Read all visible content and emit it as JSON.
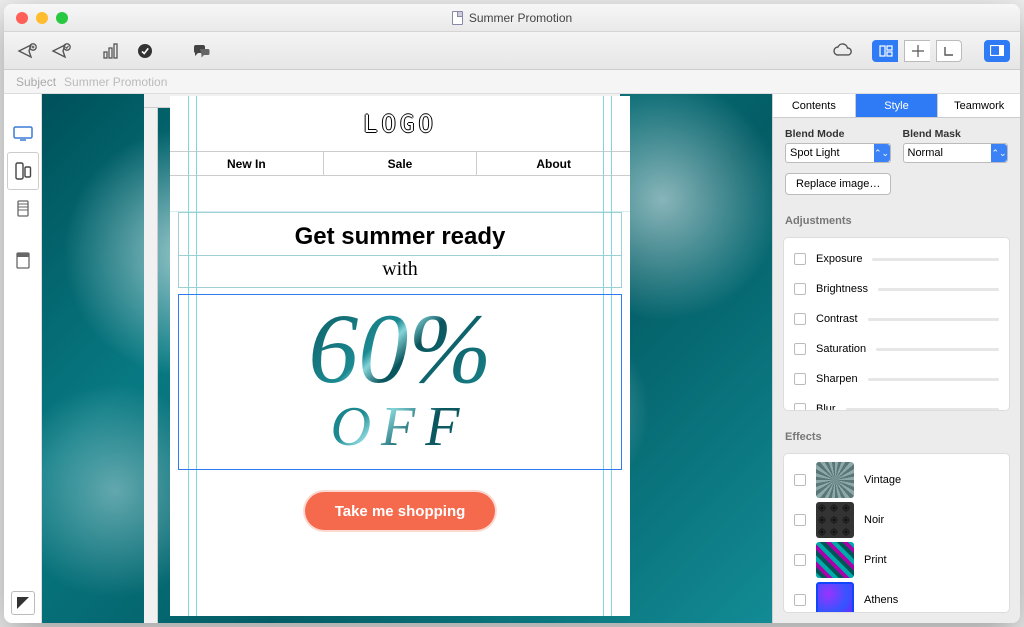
{
  "titlebar": {
    "title": "Summer Promotion"
  },
  "subject": {
    "label": "Subject",
    "value": "Summer Promotion"
  },
  "email": {
    "logo": "LOGO",
    "nav": [
      "New In",
      "Sale",
      "About"
    ],
    "headline": "Get summer ready",
    "sub": "with",
    "percent": "60%",
    "off": "OFF",
    "cta": "Take me shopping"
  },
  "inspector": {
    "tabs": [
      "Contents",
      "Style",
      "Teamwork"
    ],
    "active_tab": 1,
    "blend": {
      "mode_label": "Blend Mode",
      "mode_value": "Spot Light",
      "mask_label": "Blend Mask",
      "mask_value": "Normal"
    },
    "replace_btn": "Replace image…",
    "adjustments_label": "Adjustments",
    "adjustments": [
      "Exposure",
      "Brightness",
      "Contrast",
      "Saturation",
      "Sharpen",
      "Blur"
    ],
    "effects_label": "Effects",
    "effects": [
      "Vintage",
      "Noir",
      "Print",
      "Athens"
    ]
  }
}
